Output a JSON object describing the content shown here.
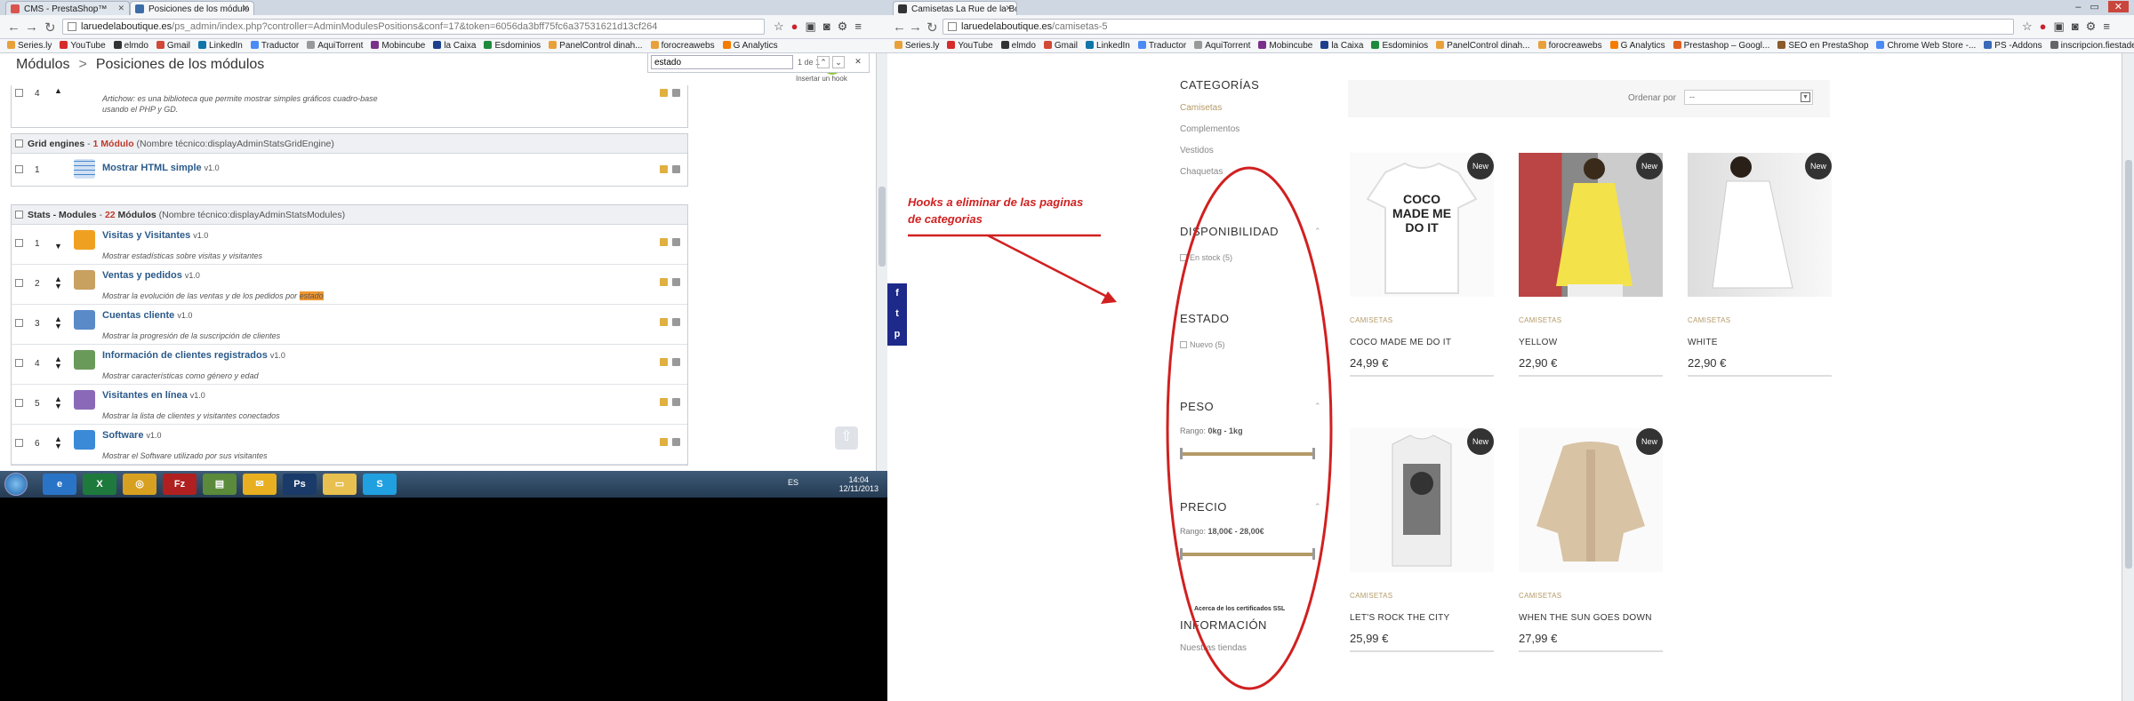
{
  "left": {
    "tabs": [
      {
        "title": "CMS - PrestaShop™",
        "fav": "#d9534f"
      },
      {
        "title": "Posiciones de los módulo",
        "fav": "#3b6ea8"
      }
    ],
    "url": {
      "host": "laruedelaboutique.es",
      "path": "/ps_admin/index.php?controller=AdminModulesPositions&conf=17&token=6056da3bff75fc6a37531621d13cf264"
    },
    "bookmarks": [
      {
        "label": "Series.ly",
        "color": "#e8a13a"
      },
      {
        "label": "YouTube",
        "color": "#d62b2b"
      },
      {
        "label": "elmdo",
        "color": "#333333"
      },
      {
        "label": "Gmail",
        "color": "#d14836"
      },
      {
        "label": "LinkedIn",
        "color": "#0e76a8"
      },
      {
        "label": "Traductor",
        "color": "#4a8af4"
      },
      {
        "label": "AquiTorrent",
        "color": "#999999"
      },
      {
        "label": "Mobincube",
        "color": "#7a2f8a"
      },
      {
        "label": "la Caixa",
        "color": "#1b3f8a"
      },
      {
        "label": "Esdominios",
        "color": "#1e8a3c"
      },
      {
        "label": "PanelControl dinah...",
        "color": "#e8a13a"
      },
      {
        "label": "forocreawebs",
        "color": "#e8a13a"
      },
      {
        "label": "G Analytics",
        "color": "#f57c00"
      }
    ],
    "breadcrumb": [
      "Módulos",
      "Posiciones de los módulos"
    ],
    "breadcrumb_sep": ">",
    "find": {
      "query": "estado",
      "count": "1 de 1"
    },
    "hook_button": "Insertar un hook",
    "top_partial": {
      "num": "4",
      "desc1": "Artichow: es una biblioteca que permite mostrar simples gráficos cuadro-base",
      "desc2": "usando el PHP y GD."
    },
    "grid": {
      "title": "Grid engines",
      "sep": " - ",
      "count": "1 Módulo",
      "tech": " (Nombre técnico:displayAdminStatsGridEngine)",
      "modules": [
        {
          "num": "1",
          "name": "Mostrar HTML simple",
          "ver": "v1.0",
          "desc": "",
          "color": "#4a86c8"
        }
      ]
    },
    "stats": {
      "title": "Stats - Modules",
      "sep": " - ",
      "count": "22",
      "count_suffix": " Módulos",
      "tech": " (Nombre técnico:displayAdminStatsModules)",
      "modules": [
        {
          "num": "1",
          "name": "Visitas y Visitantes",
          "ver": "v1.0",
          "desc": "Mostrar estadísticas sobre visitas y visitantes",
          "color": "#f0a020"
        },
        {
          "num": "2",
          "name": "Ventas y pedidos",
          "ver": "v1.0",
          "desc": "Mostrar la evolución de las ventas y de los pedidos por",
          "highlight": "estado",
          "color": "#c8a060"
        },
        {
          "num": "3",
          "name": "Cuentas cliente",
          "ver": "v1.0",
          "desc": "Mostrar la progresión de la suscripción de clientes",
          "color": "#5a8ac8"
        },
        {
          "num": "4",
          "name": "Información de clientes registrados",
          "ver": "v1.0",
          "desc": "Mostrar características como género y edad",
          "color": "#6a9a5a"
        },
        {
          "num": "5",
          "name": "Visitantes en línea",
          "ver": "v1.0",
          "desc": "Mostrar la lista de clientes y visitantes conectados",
          "color": "#8a6ab8"
        },
        {
          "num": "6",
          "name": "Software",
          "ver": "v1.0",
          "desc": "Mostrar el Software utilizado por sus visitantes",
          "color": "#3a8ad8"
        }
      ]
    },
    "taskbar": {
      "apps": [
        {
          "label": "e",
          "color": "#2a74c8"
        },
        {
          "label": "X",
          "color": "#1e7a3c"
        },
        {
          "label": "◎",
          "color": "#d8a020"
        },
        {
          "label": "Fz",
          "color": "#b02020"
        },
        {
          "label": "▤",
          "color": "#5a8a3a"
        },
        {
          "label": "✉",
          "color": "#e8b020"
        },
        {
          "label": "Ps",
          "color": "#1a3a6a"
        },
        {
          "label": "▭",
          "color": "#e8c050"
        },
        {
          "label": "S",
          "color": "#20a0e0"
        }
      ],
      "lang": "ES",
      "time": "14:04",
      "date": "12/11/2013"
    }
  },
  "right": {
    "tab": {
      "title": "Camisetas La Rue de la Bo",
      "fav": "#333333"
    },
    "url": {
      "host": "laruedelaboutique.es",
      "path": "/camisetas-5"
    },
    "bookmarks": [
      {
        "label": "Series.ly",
        "color": "#e8a13a"
      },
      {
        "label": "YouTube",
        "color": "#d62b2b"
      },
      {
        "label": "elmdo",
        "color": "#333333"
      },
      {
        "label": "Gmail",
        "color": "#d14836"
      },
      {
        "label": "LinkedIn",
        "color": "#0e76a8"
      },
      {
        "label": "Traductor",
        "color": "#4a8af4"
      },
      {
        "label": "AquiTorrent",
        "color": "#999999"
      },
      {
        "label": "Mobincube",
        "color": "#7a2f8a"
      },
      {
        "label": "la Caixa",
        "color": "#1b3f8a"
      },
      {
        "label": "Esdominios",
        "color": "#1e8a3c"
      },
      {
        "label": "PanelControl dinah...",
        "color": "#e8a13a"
      },
      {
        "label": "forocreawebs",
        "color": "#e8a13a"
      },
      {
        "label": "G Analytics",
        "color": "#f57c00"
      },
      {
        "label": "Prestashop – Googl...",
        "color": "#e06020"
      },
      {
        "label": "SEO en PrestaShop",
        "color": "#8a5a2a"
      },
      {
        "label": "Chrome Web Store -...",
        "color": "#4a8af4"
      },
      {
        "label": "PS -Addons",
        "color": "#3a6ab8"
      },
      {
        "label": "inscripcion.fiestadel...",
        "color": "#666666"
      }
    ],
    "sidebar": {
      "categories_title": "CATEGORÍAS",
      "categories": [
        "Camisetas",
        "Complementos",
        "Vestidos",
        "Chaquetas"
      ],
      "availability_title": "DISPONIBILIDAD",
      "availability_option": "En stock (5)",
      "state_title": "ESTADO",
      "state_option": "Nuevo (5)",
      "weight_title": "PESO",
      "weight_label": "Rango:",
      "weight_range": "0kg - 1kg",
      "price_title": "PRECIO",
      "price_label": "Rango:",
      "price_range": "18,00€ - 28,00€",
      "ssl": "Acerca de los certificados SSL",
      "info_title": "INFORMACIÓN",
      "info_link": "Nuestras tiendas"
    },
    "sort": {
      "label": "Ordenar por",
      "value": "--"
    },
    "social": [
      "f",
      "t",
      "p"
    ],
    "products": [
      {
        "name": "COCO MADE ME DO IT",
        "category": "CAMISETAS",
        "price": "24,99 €",
        "is_new": true,
        "new_label": "New",
        "print": "COCO\nMADE ME\nDO IT"
      },
      {
        "name": "YELLOW",
        "category": "CAMISETAS",
        "price": "22,90 €",
        "is_new": true,
        "new_label": "New"
      },
      {
        "name": "WHITE",
        "category": "CAMISETAS",
        "price": "22,90 €",
        "is_new": true,
        "new_label": "New"
      },
      {
        "name": "LET'S ROCK THE CITY",
        "category": "CAMISETAS",
        "price": "25,99 €",
        "is_new": true,
        "new_label": "New"
      },
      {
        "name": "WHEN THE SUN GOES DOWN",
        "category": "CAMISETAS",
        "price": "27,99 €",
        "is_new": true,
        "new_label": "New"
      }
    ],
    "annotation": {
      "line1": "Hooks a eliminar de las paginas",
      "line2": "de categorias",
      "color": "#d12020"
    }
  }
}
